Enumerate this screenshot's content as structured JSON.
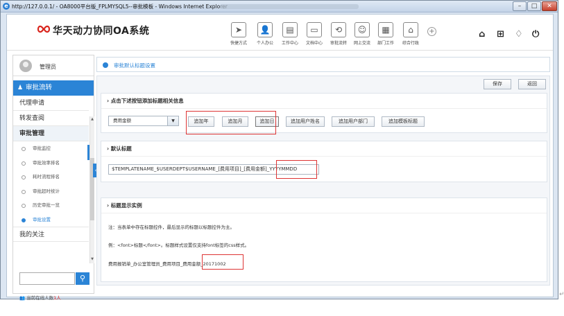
{
  "window": {
    "title": "http://127.0.0.1/ - OA8000平台版_FPLMYSQL5--审批模板 - Windows Internet Explorer"
  },
  "header": {
    "brand": "华天动力协同OA系统",
    "nav": [
      {
        "label": "快捷方式",
        "icon": "send-icon"
      },
      {
        "label": "个人办公",
        "icon": "person-icon"
      },
      {
        "label": "工作中心",
        "icon": "briefcase-icon"
      },
      {
        "label": "文档中心",
        "icon": "document-icon"
      },
      {
        "label": "审批流转",
        "icon": "flow-icon"
      },
      {
        "label": "网上交流",
        "icon": "chat-icon"
      },
      {
        "label": "部门工作",
        "icon": "dept-icon"
      },
      {
        "label": "综合行政",
        "icon": "building-icon"
      }
    ]
  },
  "sidebar": {
    "username": "管理员",
    "section_title": "审批流转",
    "items": {
      "apply": "代理申请",
      "query": "转发查阅",
      "manage": "审批管理",
      "attention": "我的关注"
    },
    "subitems": [
      "审批监控",
      "审批效率排名",
      "耗时流程排名",
      "审批超时统计",
      "历史审批一览",
      "审批设置"
    ],
    "online_label": "当前在线人数",
    "online_count": "1人"
  },
  "main": {
    "breadcrumb": "审批默认标题设置",
    "save": "保存",
    "back": "返回",
    "section1": {
      "title": "点击下述按钮添加标题相关信息",
      "select_value": "费用金额",
      "buttons": [
        "追加年",
        "追加月",
        "追加日",
        "追加用户姓名",
        "追加用户部门",
        "追加模板标题"
      ]
    },
    "section2": {
      "title": "默认标题",
      "value": "$TEMPLATENAME_$USERDEPT$USERNAME_[费用项目]_[费用金额]_YYYYMMDD"
    },
    "section3": {
      "title": "标题显示实例",
      "note1": "注：当表单中存在标题控件，最后显示的标题以标题控件为主。",
      "note2": "例：<font>标题</font>。标题样式设置仅支持font标签的css样式。",
      "example": "费用报销单_办公室管理员_费用项目_费用金额_20171002"
    }
  },
  "colors": {
    "accent": "#2b84d6",
    "highlight": "#dd3333"
  }
}
